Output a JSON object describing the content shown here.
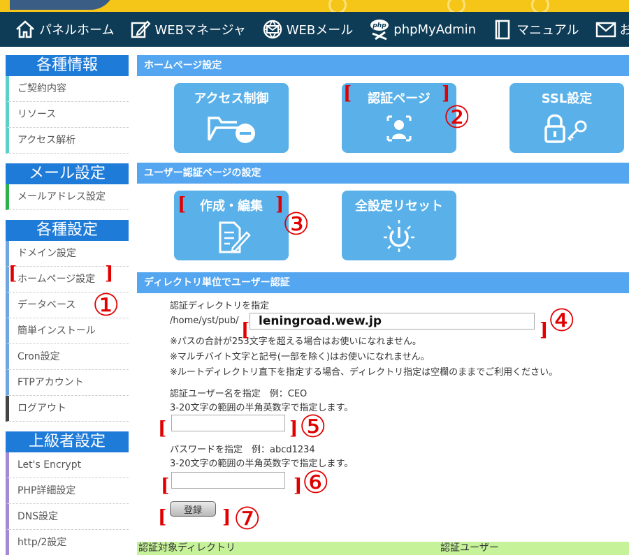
{
  "nav": {
    "items": [
      {
        "label": "パネルホーム",
        "icon": "home-icon"
      },
      {
        "label": "WEBマネージャ",
        "icon": "edit-icon"
      },
      {
        "label": "WEBメール",
        "icon": "globe-mail-icon"
      },
      {
        "label": "phpMyAdmin",
        "icon": "php-icon"
      },
      {
        "label": "マニュアル",
        "icon": "book-icon"
      },
      {
        "label": "お問い",
        "icon": "mail-icon"
      }
    ],
    "php_badge": "php"
  },
  "sidebar": {
    "groups": [
      {
        "title": "各種情報",
        "items": [
          "ご契約内容",
          "リソース",
          "アクセス解析"
        ]
      },
      {
        "title": "メール設定",
        "items": [
          "メールアドレス設定"
        ]
      },
      {
        "title": "各種設定",
        "items": [
          "ドメイン設定",
          "ホームページ設定",
          "データベース",
          "簡単インストール",
          "Cron設定",
          "FTPアカウント",
          "ログアウト"
        ]
      },
      {
        "title": "上級者設定",
        "items": [
          "Let's Encrypt",
          "PHP詳細設定",
          "DNS設定",
          "http/2設定"
        ]
      }
    ]
  },
  "main": {
    "section1": {
      "title": "ホームページ設定",
      "tiles": [
        {
          "label": "アクセス制御",
          "icon": "folder-minus-icon"
        },
        {
          "label": "認証ページ",
          "icon": "user-auth-icon"
        },
        {
          "label": "SSL設定",
          "icon": "lock-key-icon"
        }
      ]
    },
    "section2": {
      "title": "ユーザー認証ページの設定",
      "tiles": [
        {
          "label": "作成・編集",
          "icon": "document-edit-icon"
        },
        {
          "label": "全設定リセット",
          "icon": "power-reset-icon"
        }
      ]
    },
    "section3": {
      "title": "ディレクトリ単位でユーザー認証",
      "dir_label": "認証ディレクトリを指定",
      "dir_prefix": "/home/yst/pub/",
      "dir_value": "leningroad.wew.jp",
      "notes": [
        "※パスの合計が253文字を超える場合はお使いになれません。",
        "※マルチバイト文字と記号(一部を除く)はお使いになれません。",
        "※ルートディレクトリ直下を指定する場合、ディレクトリ指定は空欄のままでご利用ください。"
      ],
      "user_label": "認証ユーザー名を指定　例：CEO",
      "user_hint": "3-20文字の範囲の半角英数字で指定します。",
      "user_value": "",
      "pass_label": "パスワードを指定　例：abcd1234",
      "pass_hint": "3-20文字の範囲の半角英数字で指定します。",
      "pass_value": "",
      "submit_label": "登録"
    },
    "table": {
      "columns": [
        "認証対象ディレクトリ",
        "認証ユーザー"
      ]
    }
  },
  "annotations": {
    "markers": [
      "①",
      "②",
      "③",
      "④",
      "⑤",
      "⑥",
      "⑦"
    ],
    "open_bracket": "[",
    "close_bracket": "]"
  },
  "colors": {
    "nav_bg": "#0e3b55",
    "sidebar_head": "#1f7bd8",
    "section_head": "#54a6f0",
    "tile_bg": "#5ab1ea",
    "annotation": "#e10000",
    "table_head": "#c6f29a"
  }
}
